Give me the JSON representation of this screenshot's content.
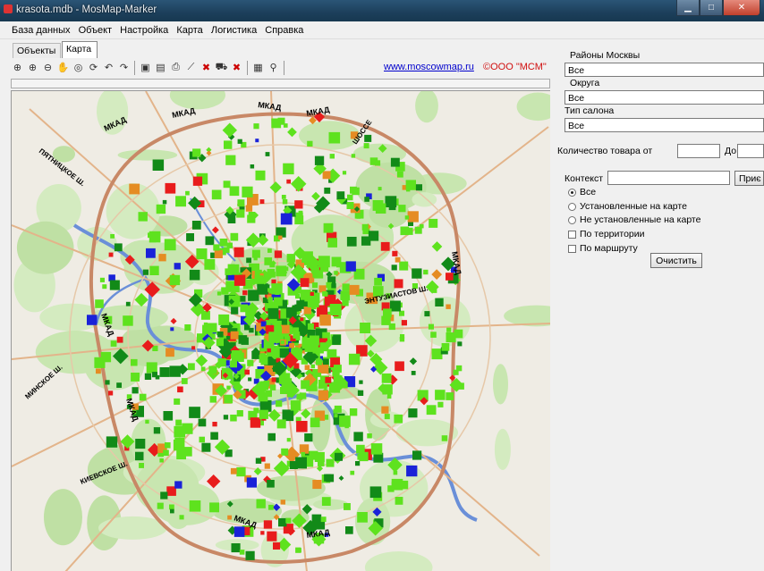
{
  "window": {
    "title": "krasota.mdb - MosMap-Marker"
  },
  "menu": [
    "База данных",
    "Объект",
    "Настройка",
    "Карта",
    "Логистика",
    "Справка"
  ],
  "tabs": [
    "Объекты",
    "Карта"
  ],
  "toolbar": {
    "icons": [
      "zoom-extents-icon",
      "zoom-in-icon",
      "zoom-out-icon",
      "pan-hand-icon",
      "zoom-region-icon",
      "refresh-icon",
      "undo-icon",
      "redo-icon",
      "copy-map-icon",
      "save-image-icon",
      "print-icon",
      "measure-ruler-icon",
      "delete-icon",
      "car-route-icon",
      "clear-route-icon",
      "layers-icon",
      "find-icon"
    ],
    "link_text": "www.moscowmap.ru",
    "copyright_text": "©ООО \"МСМ\""
  },
  "map": {
    "road_labels": [
      "МКАД",
      "МКАД",
      "МКАД",
      "МКАД",
      "МКАД",
      "МКАД",
      "МКАД",
      "МКАД",
      "МКАД",
      "ПЯТНИЦКОЕ Ш.",
      "ШОССЕ",
      "МИНСКОЕ Ш.",
      "КИЕВСКОЕ Ш.",
      "ЭНТУЗИАСТОВ Ш."
    ],
    "marker_colors": {
      "bright_green": "#5ee21e",
      "dark_green": "#128a18",
      "red": "#e81c1c",
      "orange": "#e58c23",
      "blue": "#1a22d8"
    },
    "ring_color": "#c88866"
  },
  "panel": {
    "districts_label": "Районы Москвы",
    "districts_value": "Все",
    "okrug_label": "Округа",
    "okrug_value": "Все",
    "salon_type_label": "Тип салона",
    "salon_type_value": "Все",
    "quantity_from_label": "Количество товара от",
    "quantity_to_label": "До",
    "context_label": "Контекст",
    "apply_button": "Приє",
    "radio_options": [
      "Все",
      "Установленные на карте",
      "Не установленные на карте"
    ],
    "radio_selected": 0,
    "checkboxes": [
      "По территории",
      "По маршруту"
    ],
    "clear_button": "Очистить"
  }
}
